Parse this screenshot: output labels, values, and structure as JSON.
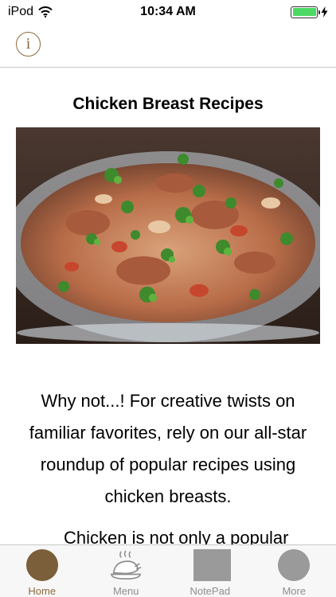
{
  "status": {
    "carrier": "iPod",
    "time": "10:34 AM",
    "battery_level": 1.0,
    "icons": [
      "wifi-icon",
      "battery-icon",
      "charging-icon"
    ]
  },
  "nav": {
    "info_icon": "info-icon",
    "info_glyph": "i"
  },
  "page": {
    "title": "Chicken Breast Recipes",
    "intro": "Why not...! For creative twists on familiar favorites, rely on our all-star roundup of popular recipes using chicken breasts.",
    "body_start": "Chicken is not only a popular"
  },
  "tabs": [
    {
      "label": "Home",
      "icon": "home-icon",
      "active": true
    },
    {
      "label": "Menu",
      "icon": "roast-chicken-icon",
      "active": false
    },
    {
      "label": "NotePad",
      "icon": "notepad-icon",
      "active": false
    },
    {
      "label": "More",
      "icon": "more-icon",
      "active": false
    }
  ],
  "colors": {
    "accent": "#8a6a3c",
    "home_circle": "#7a5f3a",
    "inactive_grey": "#9a9a9a",
    "battery_green": "#4cd964"
  }
}
